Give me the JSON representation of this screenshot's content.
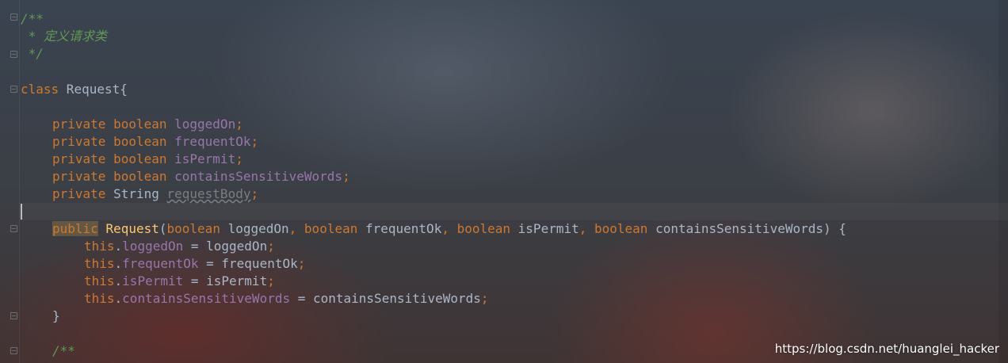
{
  "editor": {
    "comment": {
      "open": "/**",
      "body": " * 定义请求类",
      "close": " */"
    },
    "class_decl": {
      "keyword": "class",
      "name": " Request{"
    },
    "fields": [
      {
        "modifier": "private",
        "type": " boolean",
        "name": " loggedOn",
        "punct": ";"
      },
      {
        "modifier": "private",
        "type": " boolean",
        "name": " frequentOk",
        "punct": ";"
      },
      {
        "modifier": "private",
        "type": " boolean",
        "name": " isPermit",
        "punct": ";"
      },
      {
        "modifier": "private",
        "type": " boolean",
        "name": " containsSensitiveWords",
        "punct": ";"
      },
      {
        "modifier": "private",
        "type": " String ",
        "name": "requestBody",
        "punct": ";"
      }
    ],
    "ctor": {
      "modifier": "public",
      "name": "Request",
      "open_paren": "(",
      "params": [
        {
          "type": "boolean",
          "name": " loggedOn",
          "sep": ", "
        },
        {
          "type": "boolean",
          "name": " frequentOk",
          "sep": ", "
        },
        {
          "type": "boolean",
          "name": " isPermit",
          "sep": ", "
        },
        {
          "type": "boolean",
          "name": " containsSensitiveWords",
          "sep": ") {"
        }
      ],
      "assignments": [
        {
          "this": "this",
          "dot": ".",
          "field": "loggedOn",
          "rest": " = loggedOn",
          "end": ";"
        },
        {
          "this": "this",
          "dot": ".",
          "field": "frequentOk",
          "rest": " = frequentOk",
          "end": ";"
        },
        {
          "this": "this",
          "dot": ".",
          "field": "isPermit",
          "rest": " = isPermit",
          "end": ";"
        },
        {
          "this": "this",
          "dot": ".",
          "field": "containsSensitiveWords",
          "rest": " = containsSensitiveWords",
          "end": ";"
        }
      ],
      "close": "}"
    },
    "next_comment_open": "/**"
  },
  "watermark": "https://blog.csdn.net/huanglei_hacker",
  "colors": {
    "keyword": "#cc7832",
    "field": "#9876aa",
    "comment": "#629755",
    "method": "#ffc66d",
    "text": "#a9b7c6"
  }
}
